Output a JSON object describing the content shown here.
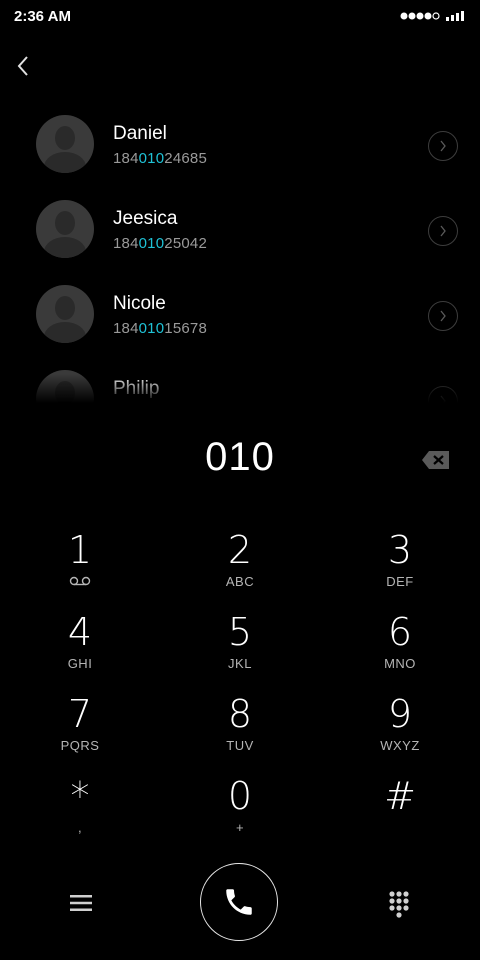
{
  "status_bar": {
    "time": "2:36 AM"
  },
  "contacts": [
    {
      "name": "Daniel",
      "number_prefix": "184",
      "number_match": "010",
      "number_suffix": "24685"
    },
    {
      "name": "Jeesica",
      "number_prefix": "184",
      "number_match": "010",
      "number_suffix": "25042"
    },
    {
      "name": "Nicole",
      "number_prefix": "184",
      "number_match": "010",
      "number_suffix": "15678"
    },
    {
      "name": "Philip",
      "number_prefix": "",
      "number_match": "",
      "number_suffix": ""
    }
  ],
  "dialer": {
    "dialed_number": "010"
  },
  "keypad": [
    {
      "digit": "1",
      "letters": ""
    },
    {
      "digit": "2",
      "letters": "ABC"
    },
    {
      "digit": "3",
      "letters": "DEF"
    },
    {
      "digit": "4",
      "letters": "GHI"
    },
    {
      "digit": "5",
      "letters": "JKL"
    },
    {
      "digit": "6",
      "letters": "MNO"
    },
    {
      "digit": "7",
      "letters": "PQRS"
    },
    {
      "digit": "8",
      "letters": "TUV"
    },
    {
      "digit": "9",
      "letters": "WXYZ"
    },
    {
      "digit": "*",
      "letters": ","
    },
    {
      "digit": "0",
      "letters": "+"
    },
    {
      "digit": "#",
      "letters": ""
    }
  ],
  "colors": {
    "background": "#000000",
    "match_highlight": "#1fc2d6",
    "secondary_text": "#9a9a9a"
  },
  "icons": {
    "back": "chevron-left-icon",
    "detail": "chevron-right-circle-icon",
    "backspace": "backspace-icon",
    "voicemail": "voicemail-icon",
    "menu": "menu-icon",
    "call": "phone-icon",
    "dialpad": "dialpad-icon"
  }
}
